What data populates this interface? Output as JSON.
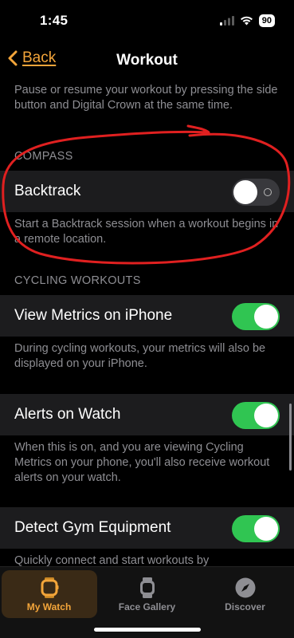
{
  "status_bar": {
    "time": "1:45",
    "battery": "90"
  },
  "nav": {
    "back_label": "Back",
    "title": "Workout"
  },
  "content": {
    "pause_footer": "Pause or resume your workout by pressing the side button and Digital Crown at the same time.",
    "compass": {
      "header": "COMPASS",
      "backtrack_label": "Backtrack",
      "backtrack_on": false,
      "backtrack_footer": "Start a Backtrack session when a workout begins in a remote location."
    },
    "cycling": {
      "header": "CYCLING WORKOUTS",
      "view_metrics_label": "View Metrics on iPhone",
      "view_metrics_on": true,
      "view_metrics_footer": "During cycling workouts, your metrics will also be displayed on your iPhone.",
      "alerts_label": "Alerts on Watch",
      "alerts_on": true,
      "alerts_footer": "When this is on, and you are viewing Cycling Metrics on your phone, you'll also receive workout alerts on your watch."
    },
    "gym": {
      "detect_label": "Detect Gym Equipment",
      "detect_on": true,
      "detect_footer": "Quickly connect and start workouts by"
    }
  },
  "tab_bar": {
    "tabs": [
      {
        "label": "My Watch",
        "icon": "watch-icon",
        "active": true
      },
      {
        "label": "Face Gallery",
        "icon": "face-gallery-icon",
        "active": false
      },
      {
        "label": "Discover",
        "icon": "compass-icon",
        "active": false
      }
    ]
  },
  "colors": {
    "accent": "#f3a53a",
    "toggle_on": "#30c552",
    "annotation": "#e02020"
  }
}
